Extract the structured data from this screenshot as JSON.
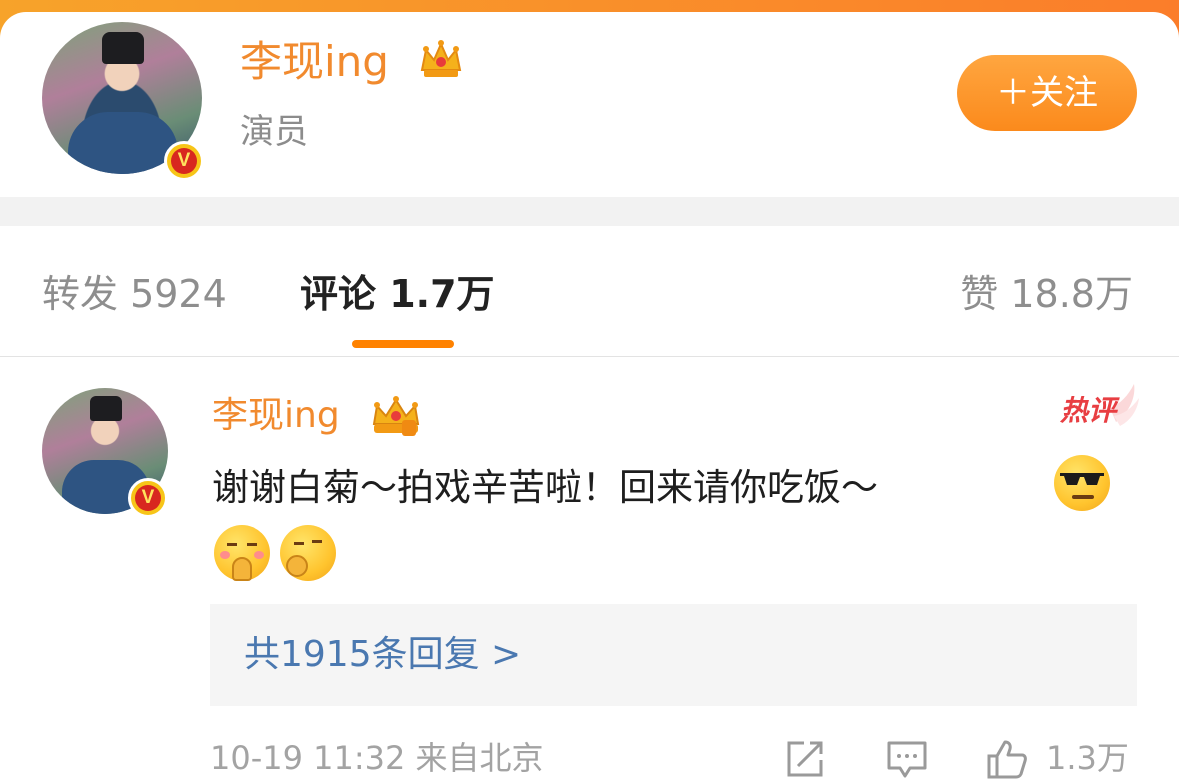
{
  "header": {
    "user_name": "李现ing",
    "subtitle": "演员",
    "follow_label": "＋关注",
    "verified_mark": "V",
    "crown_icon": "crown-icon"
  },
  "tabs": [
    {
      "label": "转发 5924",
      "active": false
    },
    {
      "label": "评论 1.7万",
      "active": true
    },
    {
      "label": "赞 18.8万",
      "active": false
    }
  ],
  "comment": {
    "user_name": "李现ing",
    "hot_label": "热评",
    "text": "谢谢白菊～拍戏辛苦啦！回来请你吃饭～",
    "emojis": [
      "cool-emoji",
      "pray-emoji",
      "thinking-emoji"
    ],
    "replies_label": "共1915条回复 >",
    "meta": "10-19 11:32 来自北京",
    "like_count": "1.3万",
    "verified_mark": "V"
  },
  "colors": {
    "accent": "#ff8200",
    "name": "#f18a2e",
    "link": "#4a78b0",
    "hot": "#e83e42"
  }
}
